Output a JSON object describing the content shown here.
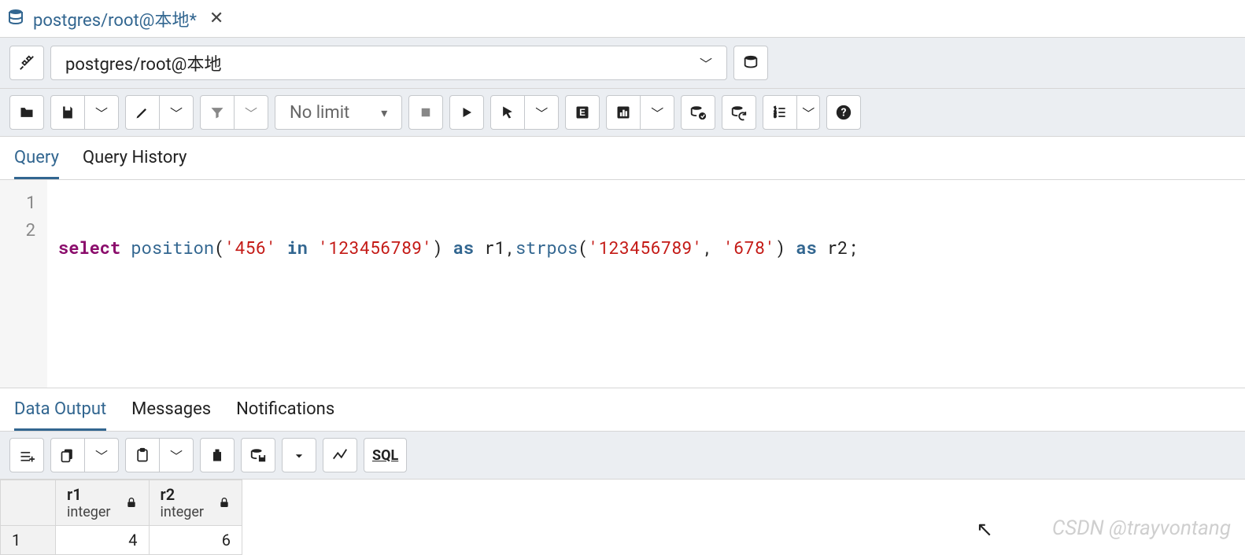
{
  "tab": {
    "title": "postgres/root@本地*"
  },
  "connection": {
    "label": "postgres/root@本地"
  },
  "toolbar": {
    "limit_label": "No limit"
  },
  "query_tabs": {
    "query": "Query",
    "history": "Query History"
  },
  "sql": {
    "tokens": [
      {
        "t": "kw",
        "v": "select"
      },
      {
        "t": "sp",
        "v": " "
      },
      {
        "t": "fn",
        "v": "position"
      },
      {
        "t": "id",
        "v": "("
      },
      {
        "t": "str",
        "v": "'456'"
      },
      {
        "t": "sp",
        "v": " "
      },
      {
        "t": "inkw",
        "v": "in"
      },
      {
        "t": "sp",
        "v": " "
      },
      {
        "t": "str",
        "v": "'123456789'"
      },
      {
        "t": "id",
        "v": ")"
      },
      {
        "t": "sp",
        "v": " "
      },
      {
        "t": "as",
        "v": "as"
      },
      {
        "t": "sp",
        "v": " "
      },
      {
        "t": "id",
        "v": "r1,"
      },
      {
        "t": "fn",
        "v": "strpos"
      },
      {
        "t": "id",
        "v": "("
      },
      {
        "t": "str",
        "v": "'123456789'"
      },
      {
        "t": "id",
        "v": ", "
      },
      {
        "t": "str",
        "v": "'678'"
      },
      {
        "t": "id",
        "v": ")"
      },
      {
        "t": "sp",
        "v": " "
      },
      {
        "t": "as",
        "v": "as"
      },
      {
        "t": "sp",
        "v": " "
      },
      {
        "t": "id",
        "v": "r2;"
      }
    ],
    "line_numbers": [
      "1",
      "2"
    ]
  },
  "output_tabs": {
    "data": "Data Output",
    "messages": "Messages",
    "notifications": "Notifications"
  },
  "grid": {
    "columns": [
      {
        "name": "r1",
        "type": "integer"
      },
      {
        "name": "r2",
        "type": "integer"
      }
    ],
    "rows": [
      {
        "rownum": "1",
        "cells": [
          "4",
          "6"
        ]
      }
    ]
  },
  "watermark": "CSDN @trayvontang",
  "sql_label": "SQL"
}
